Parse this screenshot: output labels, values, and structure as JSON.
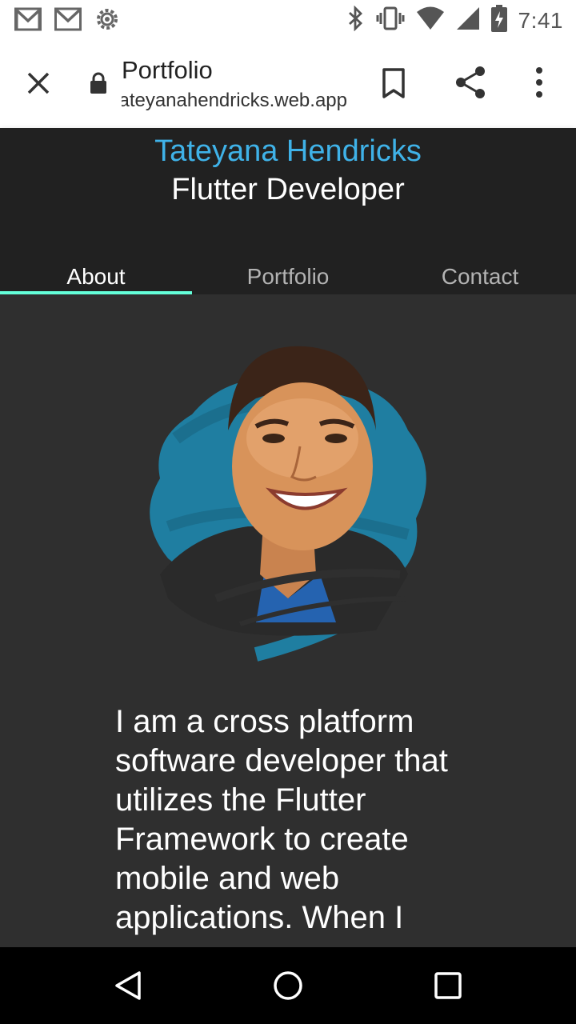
{
  "status_bar": {
    "time": "7:41",
    "left_icons": [
      "gmail-icon",
      "gmail-icon",
      "settings-icon"
    ],
    "right_icons": [
      "bluetooth-icon",
      "vibrate-icon",
      "wifi-icon",
      "signal-icon",
      "battery-charging-icon"
    ]
  },
  "browser": {
    "title": "Portfolio",
    "url": "tateyanahendricks.web.app",
    "icons": [
      "close-icon",
      "lock-icon",
      "bookmark-icon",
      "share-icon",
      "more-vert-icon"
    ]
  },
  "header": {
    "name": "Tateyana Hendricks",
    "role": "Flutter Developer",
    "name_color": "#3fb2e8",
    "indicator_color": "#64ffda"
  },
  "tabs": [
    {
      "label": "About",
      "active": true
    },
    {
      "label": "Portfolio",
      "active": false
    },
    {
      "label": "Contact",
      "active": false
    }
  ],
  "about": {
    "bio": "I am a cross platform software developer that utilizes the Flutter Framework to create mobile and web applications. When I"
  },
  "nav_bar": {
    "icons": [
      "back-icon",
      "home-icon",
      "recents-icon"
    ]
  }
}
